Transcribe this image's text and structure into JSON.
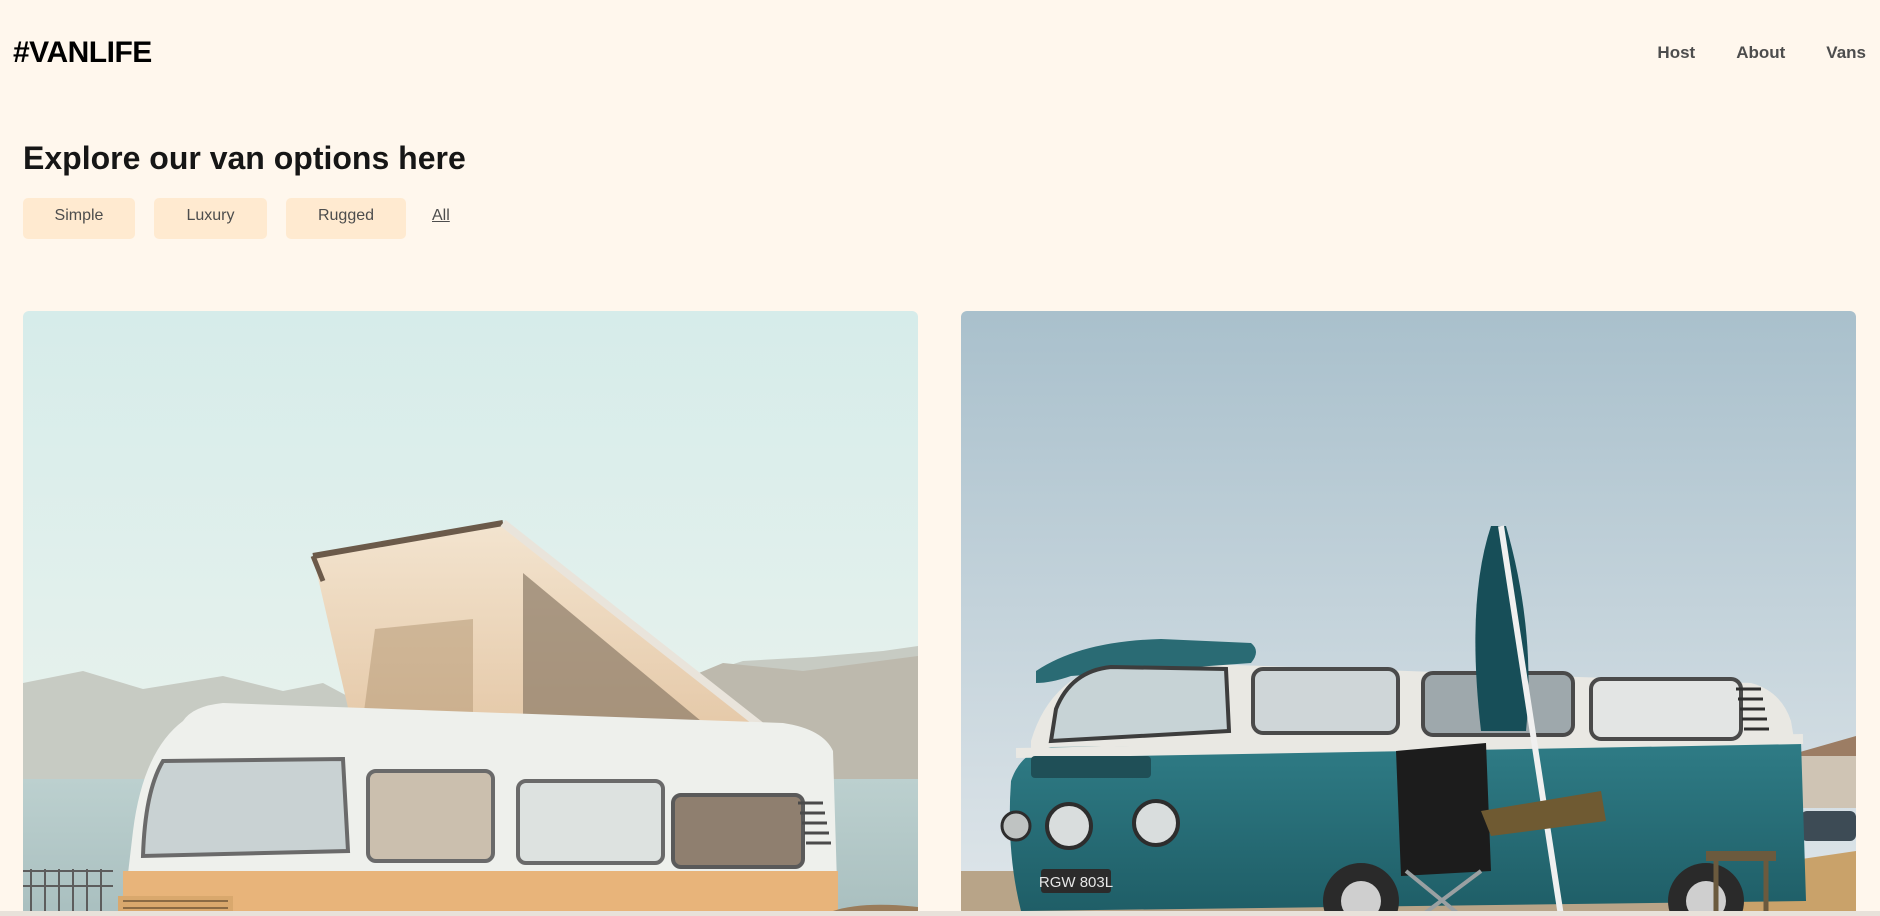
{
  "header": {
    "logo": "#VANLIFE",
    "nav": [
      {
        "label": "Host"
      },
      {
        "label": "About"
      },
      {
        "label": "Vans"
      }
    ]
  },
  "main": {
    "title": "Explore our van options here",
    "filters": [
      {
        "label": "Simple"
      },
      {
        "label": "Luxury"
      },
      {
        "label": "Rugged"
      }
    ],
    "clear_filter_label": "All",
    "vans": [
      {
        "image": "beige-popup-camper-van-photo",
        "plate": ""
      },
      {
        "image": "teal-vw-bus-photo",
        "plate": "RGW 803L"
      }
    ]
  },
  "colors": {
    "background": "#fff7ed",
    "filter_bg": "#ffead0",
    "text_dark": "#161616",
    "text_muted": "#4d4d4d"
  }
}
